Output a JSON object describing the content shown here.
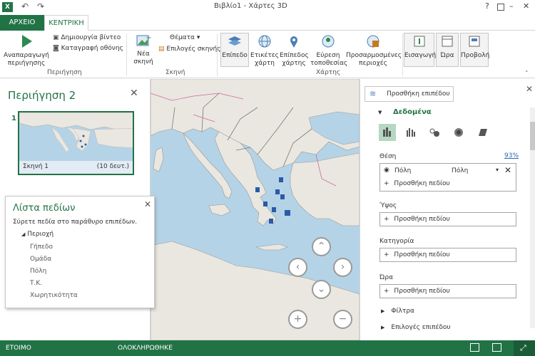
{
  "app": {
    "logo": "X",
    "title": "Βιβλίο1 - Χάρτες 3D"
  },
  "window_controls": {
    "help": "?",
    "minimize": "–",
    "close": "✕"
  },
  "tabs": [
    {
      "label": "ΑΡΧΕΙΟ"
    },
    {
      "label": "ΚΕΝΤΡΙΚΗ"
    }
  ],
  "ribbon": {
    "tour": {
      "play_label_1": "Αναπαραγωγή",
      "play_label_2": "περιήγησης",
      "create_video": "Δημιουργία βίντεο",
      "capture_screen": "Καταγραφή οθόνης",
      "group": "Περιήγηση"
    },
    "scene": {
      "new_scene_1": "Νέα",
      "new_scene_2": "σκηνή",
      "themes": "Θέματα",
      "scene_options": "Επιλογές σκηνής",
      "group": "Σκηνή"
    },
    "map": {
      "layer": "Επίπεδο",
      "map_labels_1": "Ετικέτες",
      "map_labels_2": "χάρτη",
      "flat_map_1": "Επίπεδος",
      "flat_map_2": "χάρτης",
      "find_location_1": "Εύρεση",
      "find_location_2": "τοποθεσίας",
      "custom_regions_1": "Προσαρμοσμένες",
      "custom_regions_2": "περιοχές",
      "group": "Χάρτης"
    },
    "insert": "Εισαγωγή",
    "time": "Ώρα",
    "view": "Προβολή"
  },
  "tour_pane": {
    "title": "Περιήγηση 2",
    "scene_number": "1",
    "scene_name": "Σκηνή 1",
    "scene_duration": "(10 δευτ.)"
  },
  "field_list": {
    "title": "Λίστα πεδίων",
    "hint": "Σύρετε πεδία στο παράθυρο επιπέδων.",
    "table": "Περιοχή",
    "fields": [
      "Γήπεδο",
      "Ομάδα",
      "Πόλη",
      "Τ.Κ.",
      "Χωρητικότητα"
    ]
  },
  "layer_pane": {
    "add_layer": "Προσθήκη επιπέδου",
    "data_section": "Δεδομένα",
    "location_label": "Θέση",
    "location_percent": "93%",
    "location_field": "Πόλη",
    "location_type": "Πόλη",
    "add_field": "Προσθήκη πεδίου",
    "height_label": "Ύψος",
    "category_label": "Κατηγορία",
    "time_label": "Ώρα",
    "filters": "Φίλτρα",
    "layer_options": "Επιλογές επιπέδου"
  },
  "status": {
    "ready": "ΕΤΟΙΜΟ",
    "completed": "ΟΛΟΚΛΗΡΩΘΗΚΕ"
  },
  "colors": {
    "accent": "#217346",
    "map_marker": "#2a5aa8"
  }
}
